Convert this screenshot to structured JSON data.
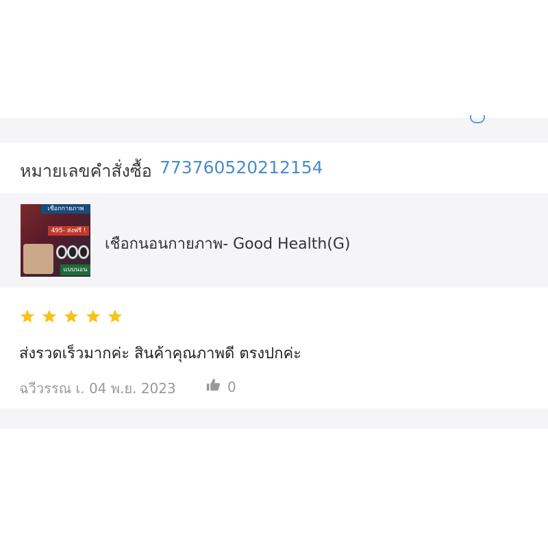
{
  "order": {
    "label": "หมายเลขคำสั่งซื้อ",
    "number": "773760520212154"
  },
  "product": {
    "name": "เชือกนอนกายภาพ- Good Health(G)",
    "thumbnail": {
      "top_text": "เชือกกายภาพ",
      "mid_text": "495- ส่งฟรี !",
      "bottom_text": "แบบนอน"
    }
  },
  "review": {
    "rating": 5,
    "rating_max": 5,
    "star_color": "#f7c21b",
    "comment": "ส่งรวดเร็วมากค่ะ  สินค้าคุณภาพดี ตรงปกค่ะ",
    "author_date": "ฉวีวรรณ เ. 04 พ.ย. 2023",
    "likes": "0"
  },
  "colors": {
    "accent": "#4a8cc9",
    "band": "#f5f5f7"
  }
}
